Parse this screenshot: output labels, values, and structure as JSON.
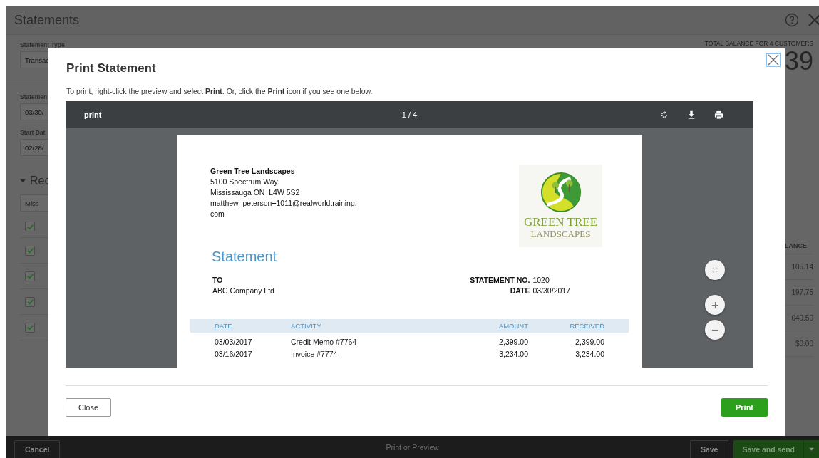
{
  "background_page": {
    "title": "Statements",
    "statement_type": {
      "label": "Statement Type",
      "value": "Transac"
    },
    "statement_date": {
      "label": "Statemen",
      "value": "03/30/"
    },
    "start_date": {
      "label": "Start Dat",
      "value": "02/28/"
    },
    "section": {
      "title": "Rec",
      "expanded": true
    },
    "filter_field": {
      "placeholder": "Miss"
    },
    "total_balance": {
      "label": "TOTAL BALANCE FOR 4 CUSTOMERS",
      "value": "39"
    },
    "table": {
      "header": {
        "checked": true,
        "column_label": "LANCE"
      },
      "rows": [
        {
          "checked": true,
          "balance": "105.14"
        },
        {
          "checked": true,
          "balance": "197.75"
        },
        {
          "checked": true,
          "balance": "040.50"
        },
        {
          "checked": true,
          "balance": "$0.00"
        }
      ]
    }
  },
  "bottom_bar": {
    "cancel": "Cancel",
    "center_label": "Print or Preview",
    "save": "Save",
    "save_and_send": "Save and send"
  },
  "dialog": {
    "title": "Print Statement",
    "instructions": "To print, right-click the preview and select **Print**. Or, click the **Print** icon if you see one below.",
    "viewer": {
      "title": "print",
      "page_indicator": "1 / 4"
    },
    "document": {
      "company": {
        "name": "Green Tree Landscapes",
        "lines": [
          "5100 Spectrum Way",
          "Mississauga ON  L4W 5S2",
          "matthew_peterson+1011@realworldtraining.",
          "com"
        ]
      },
      "logo": {
        "line_1": "GREEN TREE",
        "line_2": "LANDSCAPES"
      },
      "heading": "Statement",
      "to_label": "TO",
      "customer": "ABC Company Ltd",
      "meta": [
        {
          "label": "STATEMENT NO.",
          "value": "1020"
        },
        {
          "label": "DATE",
          "value": "03/30/2017"
        }
      ],
      "columns": [
        "DATE",
        "ACTIVITY",
        "AMOUNT",
        "RECEIVED"
      ],
      "rows": [
        {
          "date": "03/03/2017",
          "activity": "Credit Memo #7764",
          "amount": "-2,399.00",
          "received": "-2,399.00"
        },
        {
          "date": "03/16/2017",
          "activity": "Invoice #7774",
          "amount": "3,234.00",
          "received": "3,234.00"
        }
      ]
    },
    "buttons": {
      "close": "Close",
      "print": "Print"
    }
  }
}
